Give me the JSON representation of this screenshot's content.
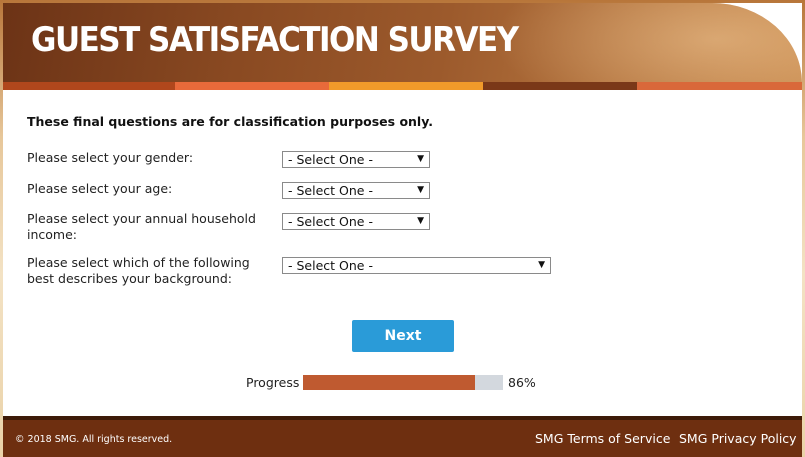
{
  "header": {
    "title": "GUEST SATISFACTION SURVEY",
    "stripe_colors": [
      "#b0471c",
      "#e86a3a",
      "#f19a2a",
      "#7a3818",
      "#d9683a"
    ]
  },
  "intro": "These final questions are for classification purposes only.",
  "questions": [
    {
      "label": "Please select your gender:",
      "value": "- Select One -"
    },
    {
      "label": "Please select your age:",
      "value": "- Select One -"
    },
    {
      "label": "Please select your annual household income:",
      "value": "- Select One -"
    },
    {
      "label": "Please select which of the following best describes your background:",
      "value": "- Select One -"
    }
  ],
  "next_label": "Next",
  "progress": {
    "label": "Progress",
    "value_text": "86%",
    "fraction": 0.86
  },
  "footer": {
    "copyright": "© 2018 SMG. All rights reserved.",
    "terms": "SMG Terms of Service",
    "privacy": "SMG Privacy Policy"
  },
  "colors": {
    "accent_button": "#2a9bd8",
    "progress_fill": "#bf5a30",
    "footer_bg": "#6e2f10"
  }
}
